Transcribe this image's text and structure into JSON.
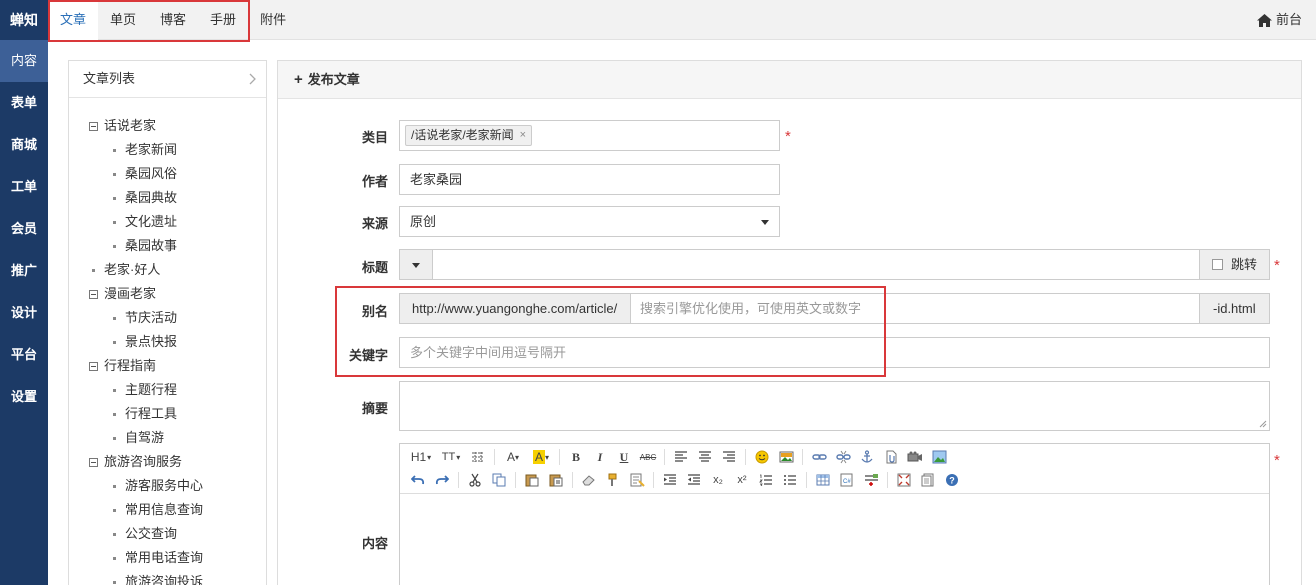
{
  "sidebar": {
    "brand": "蝉知",
    "items": [
      {
        "label": "内容",
        "active": true
      },
      {
        "label": "表单"
      },
      {
        "label": "商城"
      },
      {
        "label": "工单"
      },
      {
        "label": "会员"
      },
      {
        "label": "推广"
      },
      {
        "label": "设计"
      },
      {
        "label": "平台"
      },
      {
        "label": "设置"
      }
    ]
  },
  "topnav": {
    "tabs": [
      "文章",
      "单页",
      "博客",
      "手册",
      "附件"
    ],
    "active": "文章",
    "frontdesk": "前台"
  },
  "tree": {
    "title": "文章列表",
    "groups": [
      {
        "label": "话说老家",
        "children": [
          "老家新闻",
          "桑园风俗",
          "桑园典故",
          "文化遗址",
          "桑园故事"
        ]
      },
      {
        "label": "老家·好人",
        "children": []
      },
      {
        "label": "漫画老家",
        "children": [
          "节庆活动",
          "景点快报"
        ]
      },
      {
        "label": "行程指南",
        "children": [
          "主题行程",
          "行程工具",
          "自驾游"
        ]
      },
      {
        "label": "旅游咨询服务",
        "children": [
          "游客服务中心",
          "常用信息查询",
          "公交查询",
          "常用电话查询",
          "旅游咨询投诉"
        ]
      }
    ]
  },
  "form": {
    "title": "发布文章",
    "category": {
      "label": "类目",
      "tag": "/话说老家/老家新闻",
      "tag_close": "×"
    },
    "author": {
      "label": "作者",
      "value": "老家桑园"
    },
    "source": {
      "label": "来源",
      "value": "原创"
    },
    "title_field": {
      "label": "标题",
      "value": "",
      "jump_label": "跳转"
    },
    "alias": {
      "label": "别名",
      "prefix": "http://www.yuangonghe.com/article/",
      "placeholder": "搜索引擎优化使用，可使用英文或数字",
      "suffix": "-id.html"
    },
    "keywords": {
      "label": "关键字",
      "placeholder": "多个关键字中间用逗号隔开"
    },
    "summary": {
      "label": "摘要"
    },
    "content": {
      "label": "内容"
    },
    "required_mark": "*"
  },
  "toolbar": {
    "heading": "H1",
    "fontsize": "TT",
    "bold": "B",
    "italic": "I",
    "underline": "U",
    "strike": "ABC",
    "subscript": "x₂",
    "superscript": "x²"
  },
  "colors": {
    "sidebar_bg": "#1c3a66",
    "sidebar_active": "#3d6097",
    "accent": "#2a6fb8",
    "highlight_box": "#d9383a"
  }
}
